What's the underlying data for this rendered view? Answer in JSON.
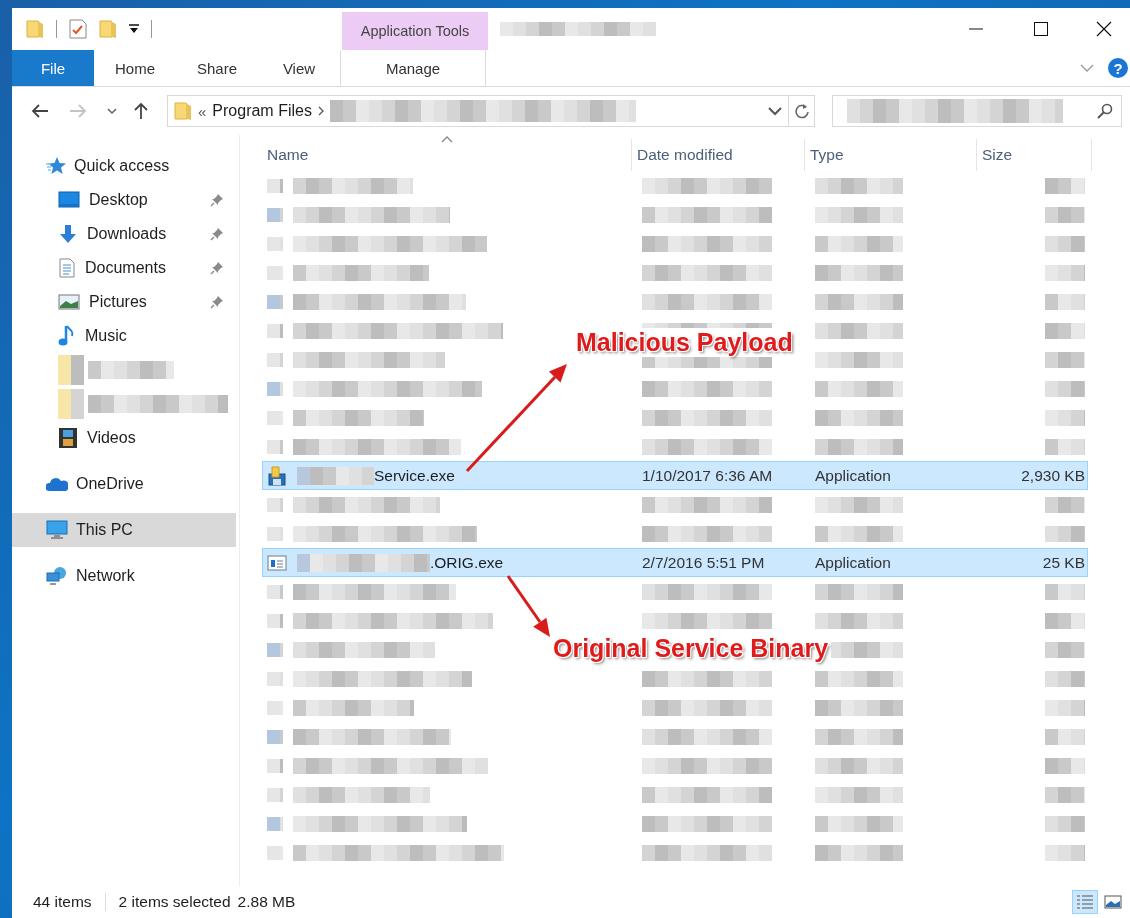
{
  "window": {
    "contextual_tab": "Application Tools",
    "help": "?"
  },
  "ribbon": {
    "tabs": [
      {
        "label": "File",
        "kind": "file",
        "selected": false
      },
      {
        "label": "Home",
        "kind": "tab",
        "selected": false
      },
      {
        "label": "Share",
        "kind": "tab",
        "selected": false
      },
      {
        "label": "View",
        "kind": "tab",
        "selected": false
      },
      {
        "label": "Manage",
        "kind": "contextual",
        "selected": false
      }
    ]
  },
  "address": {
    "overflow_mark": "«",
    "folder": "Program Files"
  },
  "nav": {
    "items": [
      {
        "label": "Quick access",
        "selected": false,
        "children": [
          {
            "kind": "item",
            "label": "Desktop",
            "pinned": true,
            "selected": false
          },
          {
            "kind": "item",
            "label": "Downloads",
            "pinned": true,
            "selected": false
          },
          {
            "kind": "item",
            "label": "Documents",
            "pinned": true,
            "selected": false
          },
          {
            "kind": "item",
            "label": "Pictures",
            "pinned": true,
            "selected": false
          },
          {
            "kind": "item",
            "label": "Music",
            "pinned": false,
            "selected": false
          },
          {
            "kind": "redacted"
          },
          {
            "kind": "redacted"
          },
          {
            "kind": "item",
            "label": "Videos",
            "pinned": false,
            "selected": false
          }
        ]
      },
      {
        "label": "OneDrive",
        "selected": false
      },
      {
        "label": "This PC",
        "selected": true
      },
      {
        "label": "Network",
        "selected": false
      }
    ]
  },
  "files": {
    "columns": [
      {
        "label": "Name",
        "sorted": true
      },
      {
        "label": "Date modified",
        "sorted": false
      },
      {
        "label": "Type",
        "sorted": false
      },
      {
        "label": "Size",
        "sorted": false
      }
    ],
    "rows": [
      {
        "kind": "redacted",
        "selected": false
      },
      {
        "kind": "redacted",
        "selected": false
      },
      {
        "kind": "redacted",
        "selected": false
      },
      {
        "kind": "redacted",
        "selected": false
      },
      {
        "kind": "redacted",
        "selected": false
      },
      {
        "kind": "redacted",
        "selected": false
      },
      {
        "kind": "redacted",
        "selected": false
      },
      {
        "kind": "redacted",
        "selected": false
      },
      {
        "kind": "redacted",
        "selected": false
      },
      {
        "kind": "redacted",
        "selected": false
      },
      {
        "kind": "file",
        "name": "Service.exe",
        "date": "1/10/2017 6:36 AM",
        "type": "Application",
        "size": "2,930 KB",
        "selected": true
      },
      {
        "kind": "redacted",
        "selected": false
      },
      {
        "kind": "redacted",
        "selected": false
      },
      {
        "kind": "file",
        "name": ".ORIG.exe",
        "date": "2/7/2016 5:51 PM",
        "type": "Application",
        "size": "25 KB",
        "selected": true
      },
      {
        "kind": "redacted",
        "selected": false
      },
      {
        "kind": "redacted",
        "selected": false
      },
      {
        "kind": "redacted",
        "selected": false
      },
      {
        "kind": "redacted",
        "selected": false
      },
      {
        "kind": "redacted",
        "selected": false
      },
      {
        "kind": "redacted",
        "selected": false
      },
      {
        "kind": "redacted",
        "selected": false
      },
      {
        "kind": "redacted",
        "selected": false
      },
      {
        "kind": "redacted",
        "selected": false
      },
      {
        "kind": "redacted",
        "selected": false
      }
    ]
  },
  "status_bar": {
    "item_count": "44 items",
    "selection": "2 items selected",
    "selection_size": "2.88 MB",
    "views": [
      {
        "selected": true
      },
      {
        "selected": false
      }
    ]
  },
  "annotations": [
    {
      "text": "Malicious Payload"
    },
    {
      "text": "Original Service Binary"
    }
  ]
}
